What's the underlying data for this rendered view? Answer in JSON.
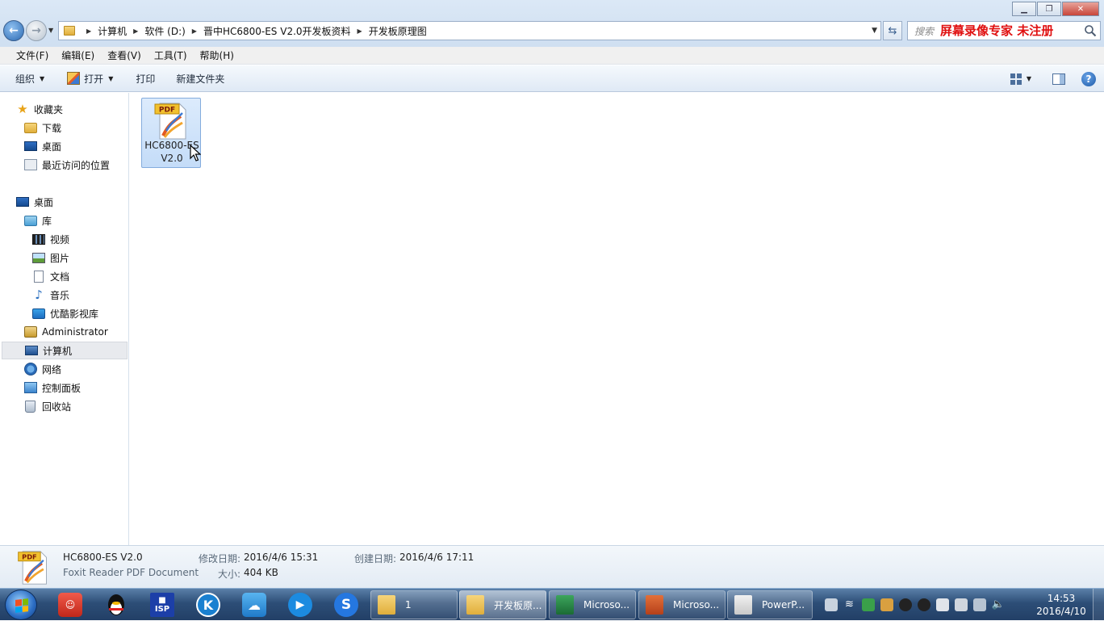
{
  "address": {
    "crumbs": [
      "计算机",
      "软件 (D:)",
      "晋中HC6800-ES V2.0开发板资料",
      "开发板原理图"
    ]
  },
  "search": {
    "placeholder": "搜索",
    "watermark": "屏幕录像专家  未注册"
  },
  "menu": [
    "文件(F)",
    "编辑(E)",
    "查看(V)",
    "工具(T)",
    "帮助(H)"
  ],
  "commands": {
    "organize": "组织",
    "open": "打开",
    "print": "打印",
    "new_folder": "新建文件夹"
  },
  "nav": {
    "favorites": "收藏夹",
    "downloads": "下载",
    "desktop_fav": "桌面",
    "recent": "最近访问的位置",
    "desktop": "桌面",
    "libraries": "库",
    "videos": "视频",
    "pictures": "图片",
    "documents": "文档",
    "music": "音乐",
    "youku": "优酷影视库",
    "admin": "Administrator",
    "computer": "计算机",
    "network": "网络",
    "control_panel": "控制面板",
    "recycle": "回收站"
  },
  "file": {
    "name": "HC6800-ES V2.0",
    "badge": "PDF"
  },
  "details": {
    "name": "HC6800-ES V2.0",
    "type": "Foxit Reader PDF Document",
    "modified_label": "修改日期:",
    "modified": "2016/4/6 15:31",
    "created_label": "创建日期:",
    "created": "2016/4/6 17:11",
    "size_label": "大小:",
    "size": "404 KB"
  },
  "taskbar": {
    "tasks": [
      "1",
      "开发板原...",
      "Microso...",
      "Microso...",
      "PowerP..."
    ],
    "time": "14:53",
    "date": "2016/4/10"
  }
}
